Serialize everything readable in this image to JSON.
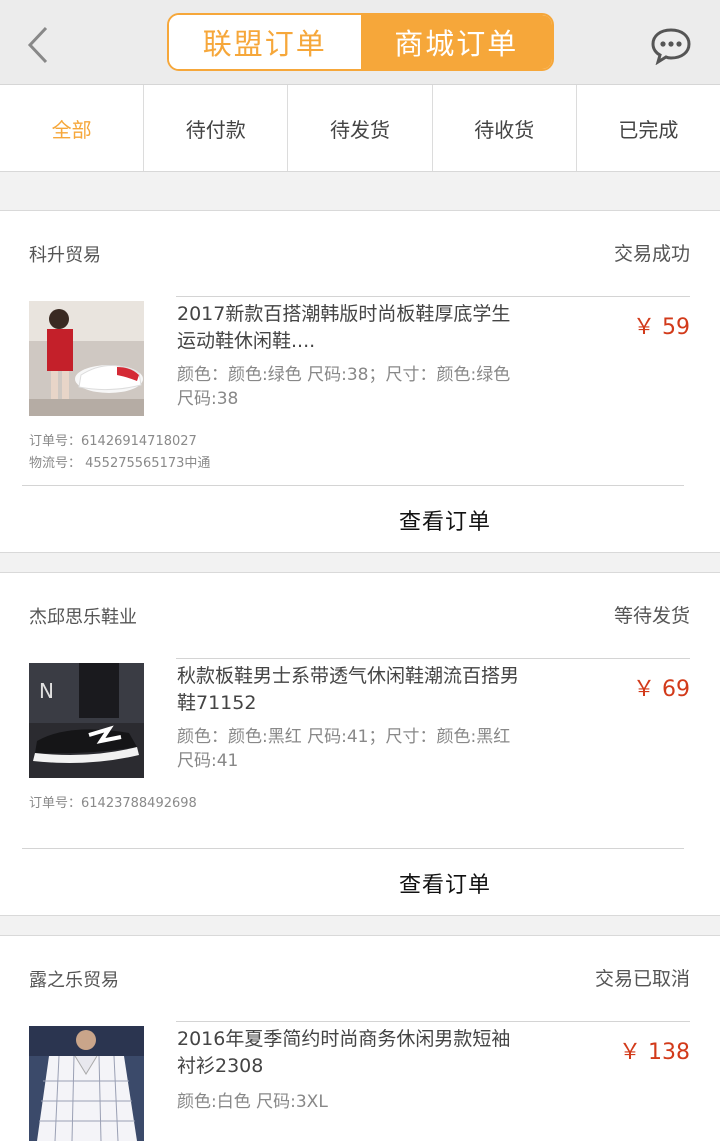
{
  "header": {
    "tabs": [
      {
        "label": "联盟订单",
        "active": false
      },
      {
        "label": "商城订单",
        "active": true
      }
    ],
    "accent_color": "#f6a73a"
  },
  "status_tabs": [
    "全部",
    "待付款",
    "待发货",
    "待收货",
    "已完成"
  ],
  "orders": [
    {
      "shop": "科升贸易",
      "status": "交易成功",
      "title": "2017新款百搭潮韩版时尚板鞋厚底学生运动鞋休闲鞋....",
      "spec": "颜色：颜色:绿色 尺码:38；尺寸：颜色:绿色 尺码:38",
      "price": "￥ 59",
      "order_no": "订单号：61426914718027",
      "logistics": "物流号： 455275565173中通",
      "button": "查看订单"
    },
    {
      "shop": "杰邱思乐鞋业",
      "status": "等待发货",
      "title": "秋款板鞋男士系带透气休闲鞋潮流百搭男鞋71152",
      "spec": "颜色：颜色:黑红 尺码:41；尺寸：颜色:黑红 尺码:41",
      "price": "￥ 69",
      "order_no": "订单号：61423788492698",
      "button": "查看订单"
    },
    {
      "shop": "露之乐贸易",
      "status": "交易已取消",
      "title": "2016年夏季简约时尚商务休闲男款短袖衬衫2308",
      "spec": "颜色:白色 尺码:3XL",
      "price": "￥ 138"
    }
  ]
}
